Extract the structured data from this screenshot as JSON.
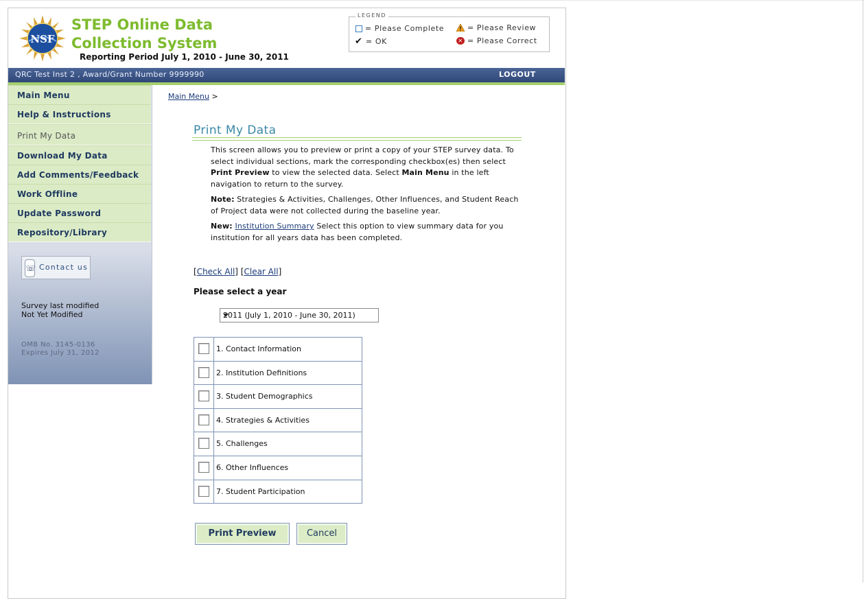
{
  "header": {
    "title": "STEP Online Data Collection System",
    "reporting_period": "Reporting Period July 1, 2010 - June 30, 2011",
    "logo_text": "NSF"
  },
  "legend": {
    "title": "LEGEND",
    "items": [
      {
        "icon": "empty-box-icon",
        "label": "= Please Complete"
      },
      {
        "icon": "warning-icon",
        "label": "= Please Review"
      },
      {
        "icon": "checkmark-icon",
        "label": "= OK"
      },
      {
        "icon": "error-icon",
        "label": "= Please Correct"
      }
    ]
  },
  "topbar": {
    "institution": "QRC Test Inst 2 , Award/Grant Number 9999990",
    "logout_label": "LOGOUT"
  },
  "sidebar": {
    "items": [
      {
        "label": "Main Menu"
      },
      {
        "label": "Help & Instructions"
      },
      {
        "label": "Print My Data"
      },
      {
        "label": "Download My Data"
      },
      {
        "label": "Add Comments/Feedback"
      },
      {
        "label": "Work Offline"
      },
      {
        "label": "Update Password"
      },
      {
        "label": "Repository/Library"
      }
    ],
    "contact_label": "Contact us",
    "survey_modified_label": "Survey last modified",
    "survey_modified_value": "Not Yet Modified",
    "omb_number": "OMB No. 3145-0136",
    "omb_expires": "Expires July 31, 2012"
  },
  "breadcrumb": {
    "link": "Main Menu",
    "separator": ">"
  },
  "main": {
    "title": "Print My Data",
    "intro_1a": "This screen allows you to preview or print a copy of your STEP survey data. To select individual sections, mark the corresponding checkbox(es) then select ",
    "intro_1b": "Print Preview",
    "intro_1c": " to view the selected data. Select ",
    "intro_1d": "Main Menu",
    "intro_1e": " in the left navigation to return to the survey.",
    "note_label": "Note:",
    "note_text": " Strategies & Activities, Challenges, Other Influences, and Student Reach of Project data were not collected during the baseline year.",
    "new_label": "New:",
    "new_link": "Institution Summary",
    "new_text": " Select this option to view summary data for you institution for all years data has been completed.",
    "check_all": "Check All",
    "clear_all": "Clear All",
    "year_prompt": "Please select a year",
    "year_selected": "2011 (July 1, 2010 - June 30, 2011)",
    "sections": [
      {
        "label": "1. Contact Information"
      },
      {
        "label": "2. Institution Definitions"
      },
      {
        "label": "3. Student Demographics"
      },
      {
        "label": "4. Strategies & Activities"
      },
      {
        "label": "5. Challenges"
      },
      {
        "label": "6. Other Influences"
      },
      {
        "label": "7. Student Participation"
      }
    ],
    "print_preview_label": "Print Preview",
    "cancel_label": "Cancel"
  },
  "colors": {
    "title_green": "#7dbb2e",
    "nav_blue": "#2f4779",
    "nav_green": "#dbebc6",
    "heading_teal": "#3a88a8"
  }
}
